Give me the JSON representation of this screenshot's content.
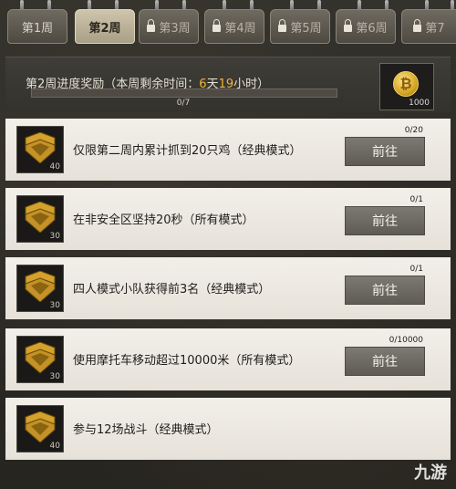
{
  "tabs": [
    {
      "label": "第1周",
      "state": "unlocked"
    },
    {
      "label": "第2周",
      "state": "active"
    },
    {
      "label": "第3周",
      "state": "locked"
    },
    {
      "label": "第4周",
      "state": "locked"
    },
    {
      "label": "第5周",
      "state": "locked"
    },
    {
      "label": "第6周",
      "state": "locked"
    },
    {
      "label": "第7",
      "state": "locked"
    }
  ],
  "header": {
    "title_prefix": "第2周进度奖励（本周剩余时间：",
    "days": "6",
    "day_unit": "天",
    "hours": "19",
    "hour_unit": "小时）",
    "progress_text": "0/7",
    "progress_fraction": 0,
    "reward_count": "1000",
    "reward_icon": "gold-coin-icon"
  },
  "go_label": "前往",
  "quests": [
    {
      "text": "仅限第二周内累计抓到20只鸡（经典模式）",
      "progress": "0/20",
      "points": "40",
      "icon": "chevron-rank-icon"
    },
    {
      "text": "在非安全区坚持20秒（所有模式）",
      "progress": "0/1",
      "points": "30",
      "icon": "chevron-rank-icon"
    },
    {
      "text": "四人模式小队获得前3名（经典模式）",
      "progress": "0/1",
      "points": "30",
      "icon": "chevron-rank-icon"
    },
    {
      "text": "使用摩托车移动超过10000米（所有模式）",
      "progress": "0/10000",
      "points": "30",
      "icon": "chevron-rank-icon"
    },
    {
      "text": "参与12场战斗（经典模式）",
      "progress": "",
      "points": "40",
      "icon": "chevron-rank-icon"
    }
  ],
  "watermark": "九游"
}
